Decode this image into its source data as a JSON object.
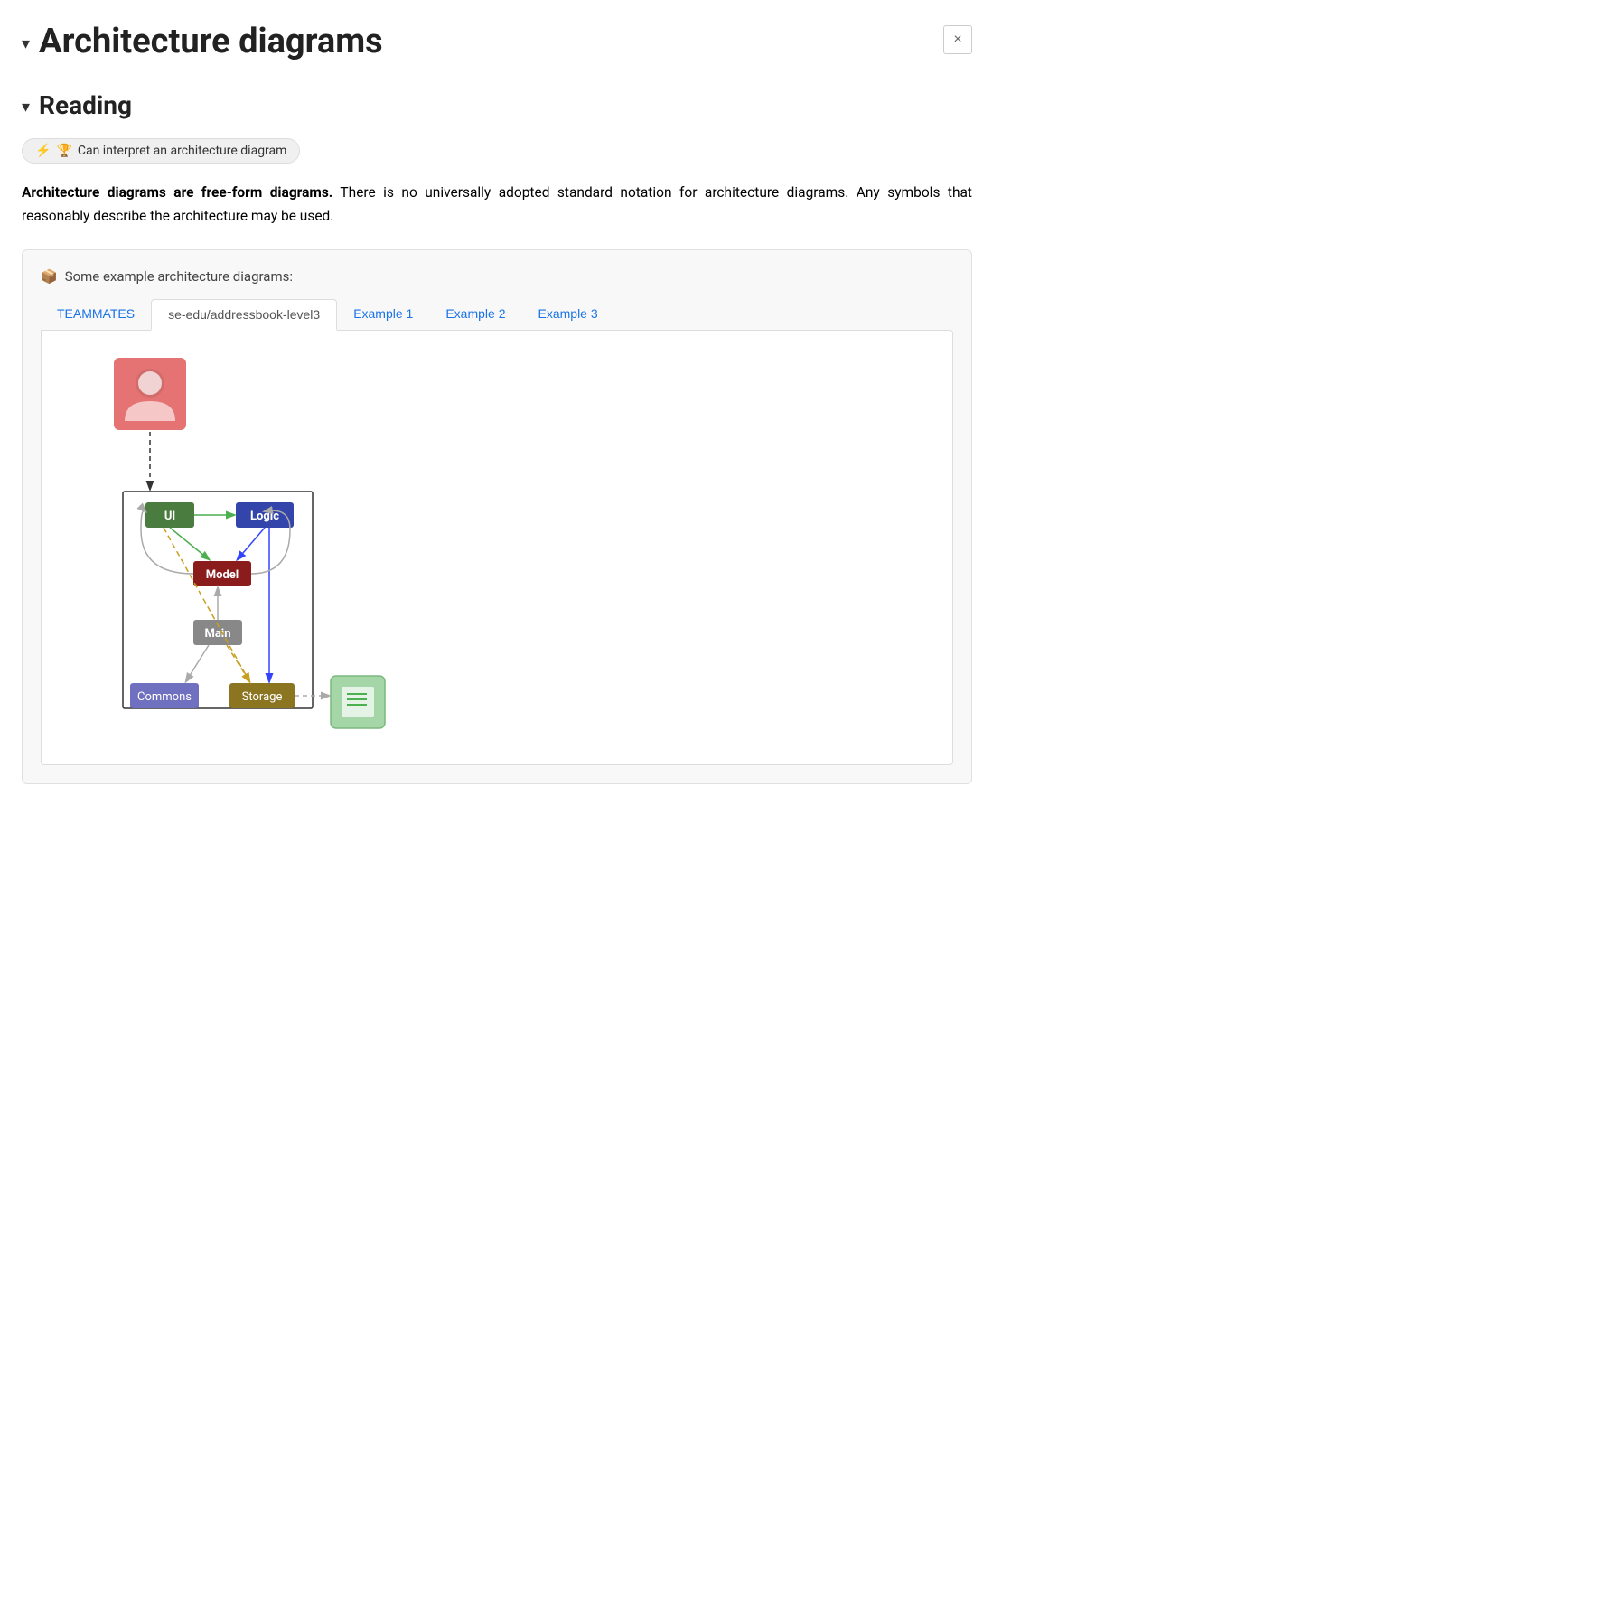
{
  "page": {
    "title": "Architecture diagrams",
    "close_label": "×",
    "chevron": "▾"
  },
  "section": {
    "title": "Reading",
    "chevron": "▾"
  },
  "badge": {
    "icon": "⚡",
    "trophy": "🏆",
    "text": "Can interpret an architecture diagram"
  },
  "description": {
    "bold_part": "Architecture diagrams are free-form diagrams.",
    "rest": " There is no universally adopted standard notation for architecture diagrams. Any symbols that reasonably describe the architecture may be used."
  },
  "example_box": {
    "icon": "📦",
    "title": "Some example architecture diagrams:"
  },
  "tabs": [
    {
      "id": "teammates",
      "label": "TEAMMATES",
      "active": false
    },
    {
      "id": "se-edu",
      "label": "se-edu/addressbook-level3",
      "active": true
    },
    {
      "id": "example1",
      "label": "Example 1",
      "active": false
    },
    {
      "id": "example2",
      "label": "Example 2",
      "active": false
    },
    {
      "id": "example3",
      "label": "Example 3",
      "active": false
    }
  ],
  "diagram": {
    "nodes": {
      "ui": {
        "label": "UI",
        "color": "#4a7c3f",
        "text_color": "#fff"
      },
      "logic": {
        "label": "Logic",
        "color": "#3344aa",
        "text_color": "#fff"
      },
      "model": {
        "label": "Model",
        "color": "#8b1c1c",
        "text_color": "#fff"
      },
      "main": {
        "label": "Main",
        "color": "#888",
        "text_color": "#fff"
      },
      "commons": {
        "label": "Commons",
        "color": "#7070c0",
        "text_color": "#fff"
      },
      "storage": {
        "label": "Storage",
        "color": "#8b7520",
        "text_color": "#fff"
      }
    }
  }
}
